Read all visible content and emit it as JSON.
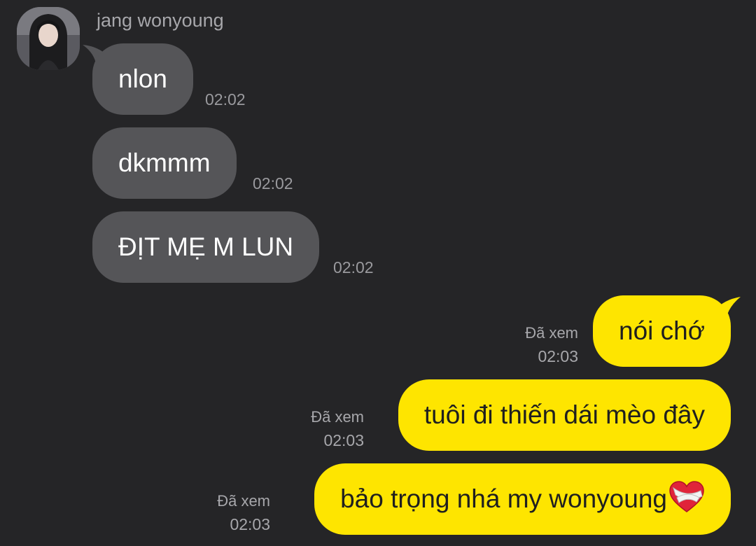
{
  "chat": {
    "sender_name": "jang wonyoung",
    "incoming": [
      {
        "text": "nlon",
        "time": "02:02"
      },
      {
        "text": "dkmmm",
        "time": "02:02"
      },
      {
        "text": "ĐỊT MẸ M LUN",
        "time": "02:02"
      }
    ],
    "outgoing": [
      {
        "text": "nói chớ",
        "read": "Đã xem",
        "time": "02:03"
      },
      {
        "text": "tuôi đi thiến dái mèo đây",
        "read": "Đã xem",
        "time": "02:03"
      },
      {
        "text": "bảo trọng nhá my wonyoung",
        "read": "Đã xem",
        "time": "02:03",
        "emoji": "mending-heart-icon"
      }
    ]
  },
  "colors": {
    "background": "#252527",
    "incoming_bubble": "#555558",
    "outgoing_bubble": "#fee500"
  }
}
